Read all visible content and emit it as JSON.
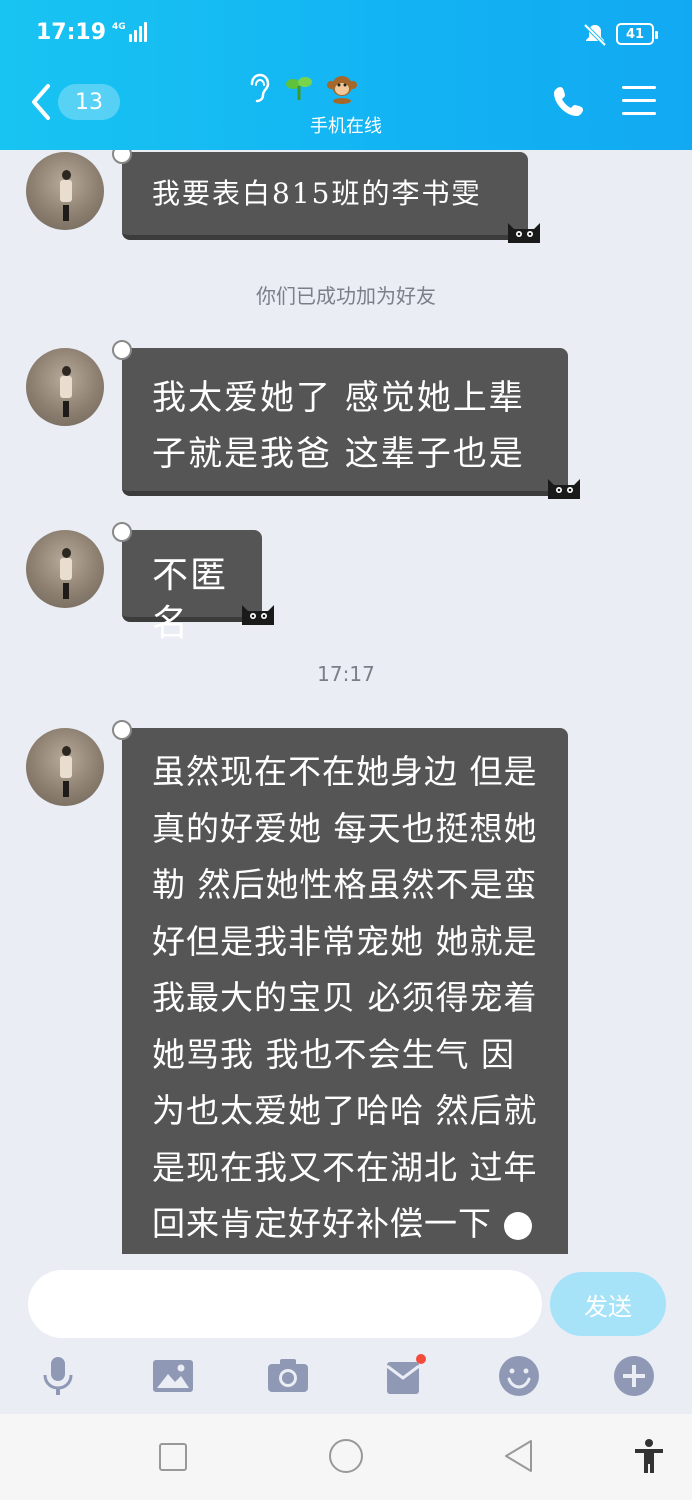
{
  "status_bar": {
    "time": "17:19",
    "network": "4G",
    "battery": "41"
  },
  "header": {
    "unread_count": "13",
    "title_icons": [
      "ear-icon",
      "sprout-icon",
      "monkey-icon"
    ],
    "subtitle": "手机在线"
  },
  "messages": [
    {
      "text": "我要表白815班的李书雯"
    },
    {
      "type": "notice",
      "text": "你们已成功加为好友"
    },
    {
      "text": "我太爱她了 感觉她上辈子就是我爸 这辈子也是"
    },
    {
      "text": "不匿名"
    },
    {
      "type": "time",
      "text": "17:17"
    },
    {
      "text": "虽然现在不在她身边 但是真的好爱她 每天也挺想她勒 然后她性格虽然不是蛮好但是我非常宠她 她就是我最大的宝贝 必须得宠着 她骂我 我也不会生气 因为也太爱她了哈哈 然后就是现在我又不在湖北 过年回来肯定好好补偿一下"
    }
  ],
  "input": {
    "placeholder": "",
    "send_label": "发送"
  },
  "toolbar": [
    "mic-icon",
    "image-icon",
    "camera-icon",
    "red-packet-icon",
    "emoji-icon",
    "plus-icon"
  ],
  "colors": {
    "header": "#13b4f3",
    "bubble": "#555555",
    "send": "#a6e3f8",
    "background": "#eaedf4"
  }
}
